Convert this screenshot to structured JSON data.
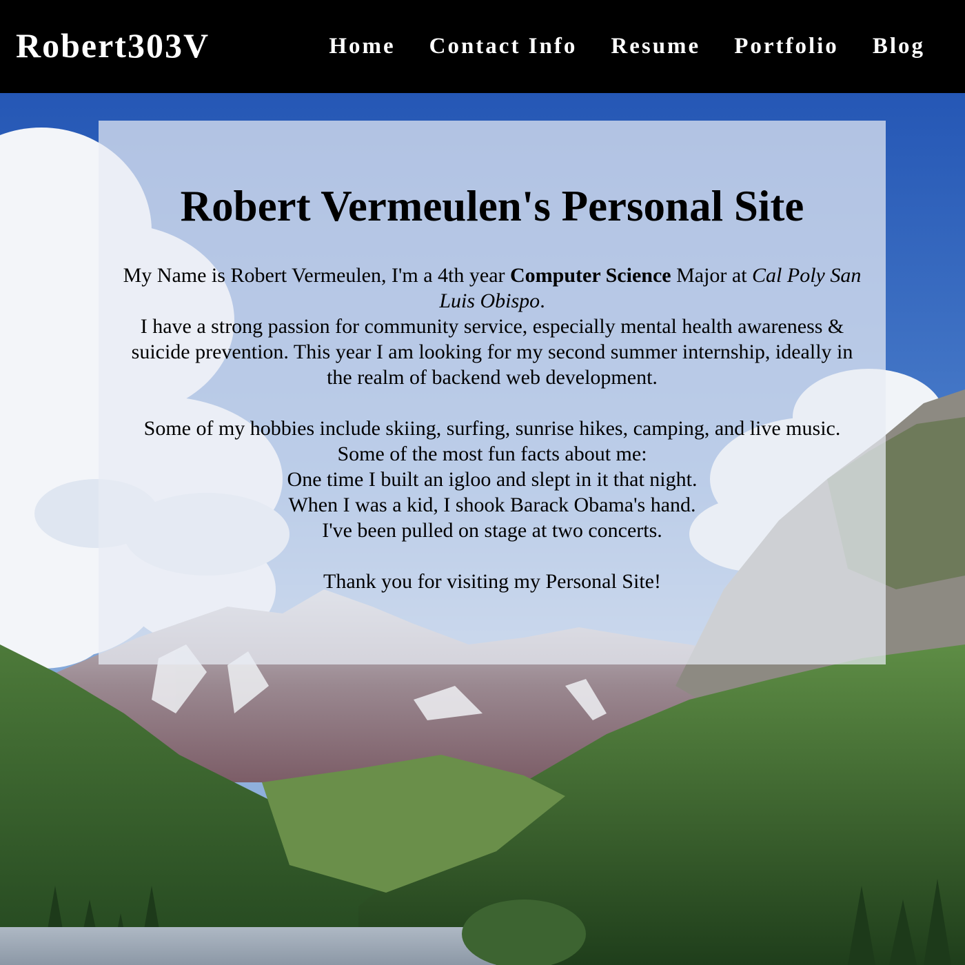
{
  "header": {
    "brand": "Robert303V",
    "nav": [
      "Home",
      "Contact Info",
      "Resume",
      "Portfolio",
      "Blog"
    ]
  },
  "main": {
    "title": "Robert Vermeulen's Personal Site",
    "intro": {
      "line1_a": "My Name is Robert Vermeulen, I'm a 4th year ",
      "line1_bold": "Computer Science",
      "line1_b": " Major at ",
      "line1_italic": "Cal Poly San Luis Obispo",
      "line1_c": ".",
      "passion": "I have a strong passion for community service, especially mental health awareness & suicide prevention. This year I am looking for my second summer internship, ideally in the realm of backend web development.",
      "hobbies": "Some of my hobbies include skiing, surfing, sunrise hikes, camping, and live music.",
      "fun_header": "Some of the most fun facts about me:",
      "facts": [
        "One time I built an igloo and slept in it that night.",
        "When I was a kid, I shook Barack Obama's hand.",
        "I've been pulled on stage at two concerts."
      ],
      "thanks": "Thank you for visiting my Personal Site!"
    }
  },
  "colors": {
    "header_bg": "#000000",
    "header_text": "#ffffff",
    "card_bg": "rgba(232,236,244,0.72)",
    "text": "#000000"
  }
}
